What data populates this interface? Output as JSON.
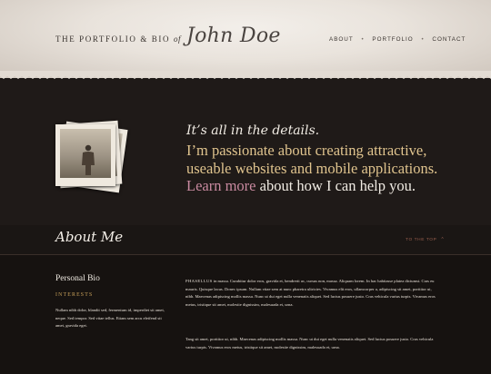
{
  "header": {
    "brand_prefix": "THE PORTFOLIO & BIO",
    "brand_of": "of",
    "signature": "John Doe",
    "nav": [
      "ABOUT",
      "PORTFOLIO",
      "CONTACT"
    ],
    "nav_separator": "•"
  },
  "hero": {
    "tagline_italic": "It’s all in the details.",
    "tagline_main": "I’m passionate about creating attractive, useable websites and mobile applications.",
    "learn_more": "Learn more",
    "tagline_end": " about how I can help you."
  },
  "about": {
    "title": "About Me",
    "to_top": "TO THE TOP",
    "to_top_icon": "chevron-up-icon"
  },
  "bio": {
    "title": "Personal Bio",
    "interests_label": "INTERESTS",
    "interests_text": "Nullam nibh dolor, blandit sed, fermentum id, imperdiet sit amet, neque. Sed tempor. Sed vitae tellus. Etiam sem arcu eleifend sit amet, gravida eget.",
    "para1_lead": "PHASELLUS",
    "para1": " in massa. Curabitur dolor eros, gravida et, hendrerit ac, cursus non, massa. Aliquam lorem. In hac habitasse platea dictumst. Cras eu mauris. Quisque lacus. Donec ipsum. Nullam vitae sem at nunc pharetra ultricies. Vivamus elit eros, ullamcorper a, adipiscing sit amet, porttitor ut, nibh. Maecenas adipiscing mollis massa. Nunc ut dui eget nulla venenatis aliquet. Sed luctus posuere justo. Cras vehicula varius turpis. Vivamus eros metus, tristique sit amet, molestie dignissim, malesuada et, urna.",
    "para2": "Tang sit amet, porttitor ut, nibh. Maecenas adipiscing mollis massa. Nunc ut dui eget nulla venenatis aliquet. Sed luctus posuere justo. Cras vehicula varius turpis. Vivamus eros metus, tristique sit amet, molestie dignissim, malesuada et, urna."
  },
  "colors": {
    "header_bg": "#ebe5de",
    "dark_bg": "#1c1816",
    "gold": "#e0c48e",
    "link_pink": "#c98aa0",
    "interests_gold": "#c9a15a"
  }
}
